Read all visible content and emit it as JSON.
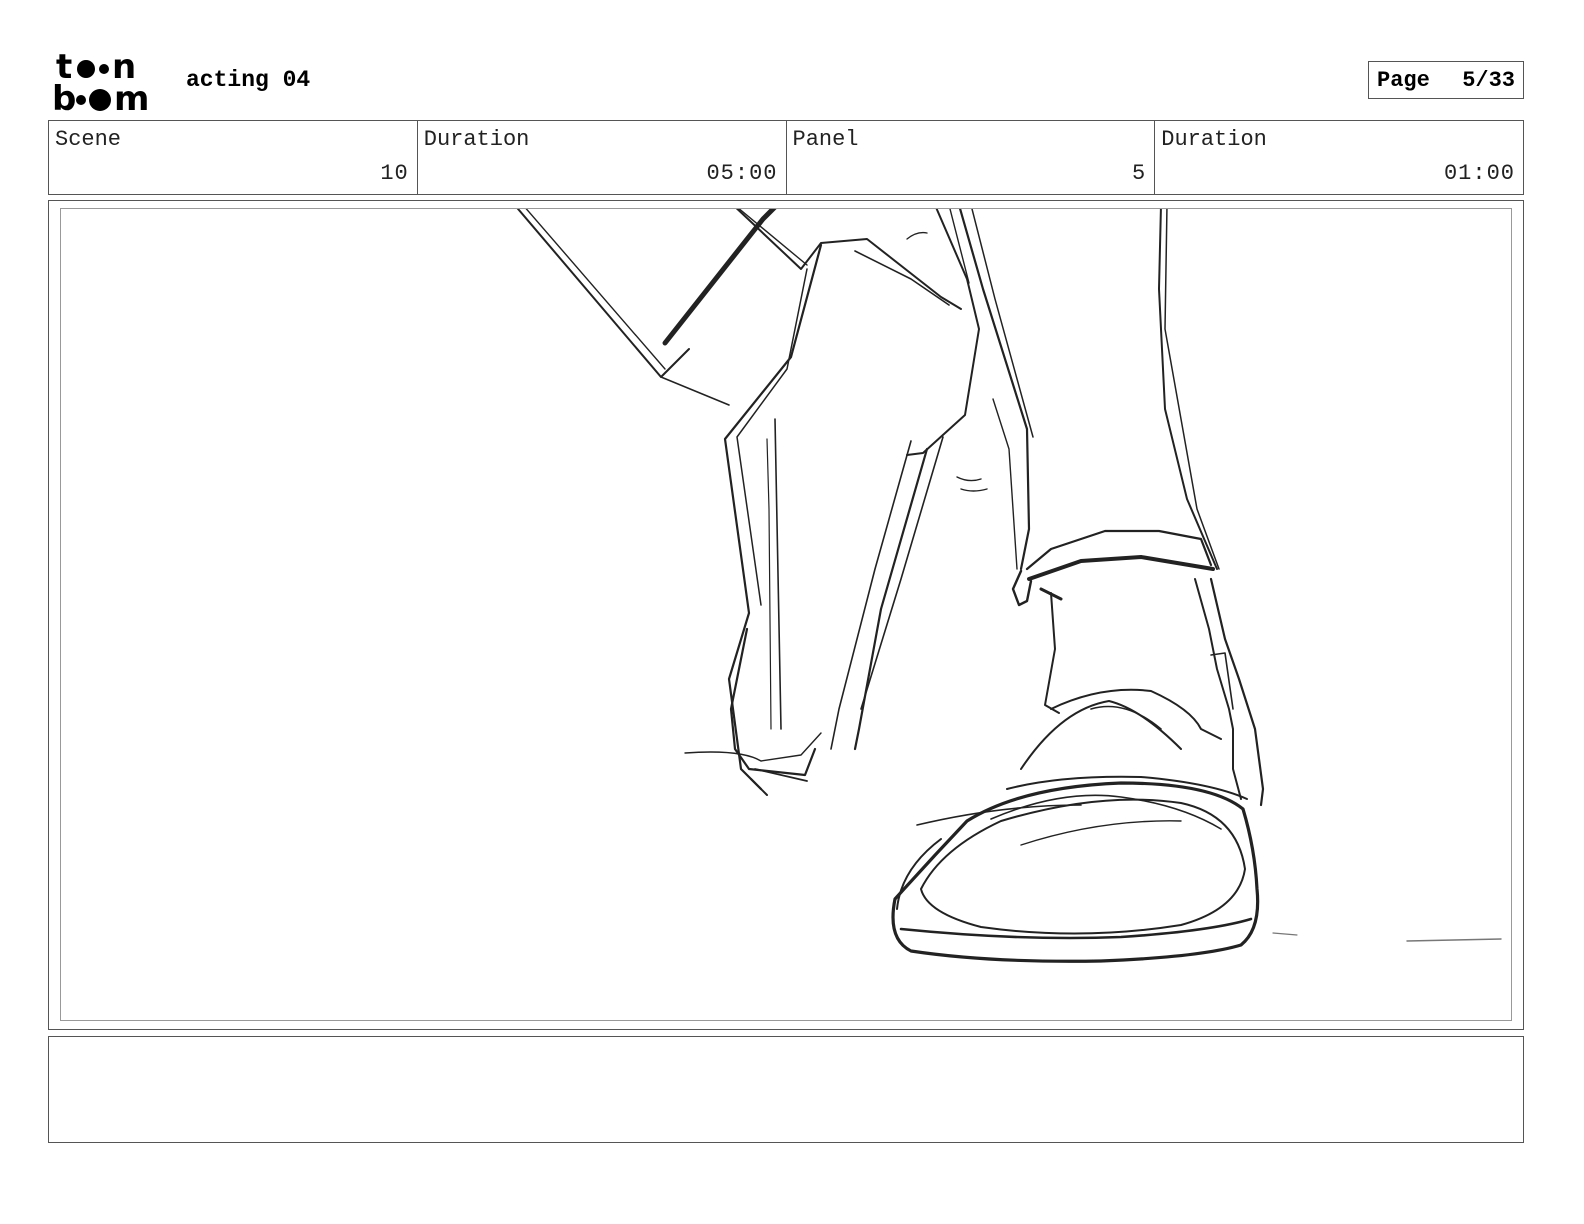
{
  "header": {
    "logo_line1": "toon",
    "logo_line2": "boom",
    "project_title": "acting 04",
    "page_label": "Page",
    "page_value": "5/33"
  },
  "info": {
    "scene_label": "Scene",
    "scene_value": "10",
    "scene_duration_label": "Duration",
    "scene_duration_value": "05:00",
    "panel_label": "Panel",
    "panel_value": "5",
    "panel_duration_label": "Duration",
    "panel_duration_value": "01:00"
  },
  "panel": {
    "sketch_subject": "pencil sketch of two walking legs and a shoe"
  },
  "notes": {
    "text": ""
  }
}
